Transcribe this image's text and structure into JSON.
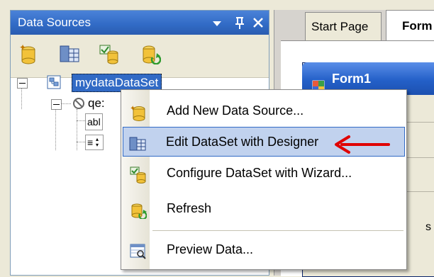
{
  "data_sources_panel": {
    "title": "Data Sources",
    "dropdown_glyph": "▾",
    "pin_glyph": "ᛘ",
    "close_glyph": "✕",
    "toolbar": [
      "add-datasource-icon",
      "edit-dataset-icon",
      "configure-dataset-icon",
      "refresh-icon"
    ]
  },
  "tree": {
    "root": "mydataDataSet",
    "child": "qe:",
    "grandchild_1": "abl",
    "grandchild_2": "≡"
  },
  "tabs": {
    "start_page": "Start Page",
    "form_tab": "Form"
  },
  "form_window": {
    "title": "Form1",
    "side_letter": "s"
  },
  "context_menu": {
    "items": [
      {
        "label": "Add New Data Source...",
        "icon": "add-datasource-icon"
      },
      {
        "label": "Edit DataSet with Designer",
        "icon": "edit-dataset-icon"
      },
      {
        "label": "Configure DataSet with Wizard...",
        "icon": "configure-dataset-icon"
      },
      {
        "label": "Refresh",
        "icon": "refresh-icon"
      },
      {
        "label": "Preview Data...",
        "icon": "preview-data-icon"
      }
    ]
  },
  "colors": {
    "selection": "#316ac5",
    "hover_highlight": "#c1d2ee",
    "annotation_arrow": "#e00000"
  }
}
